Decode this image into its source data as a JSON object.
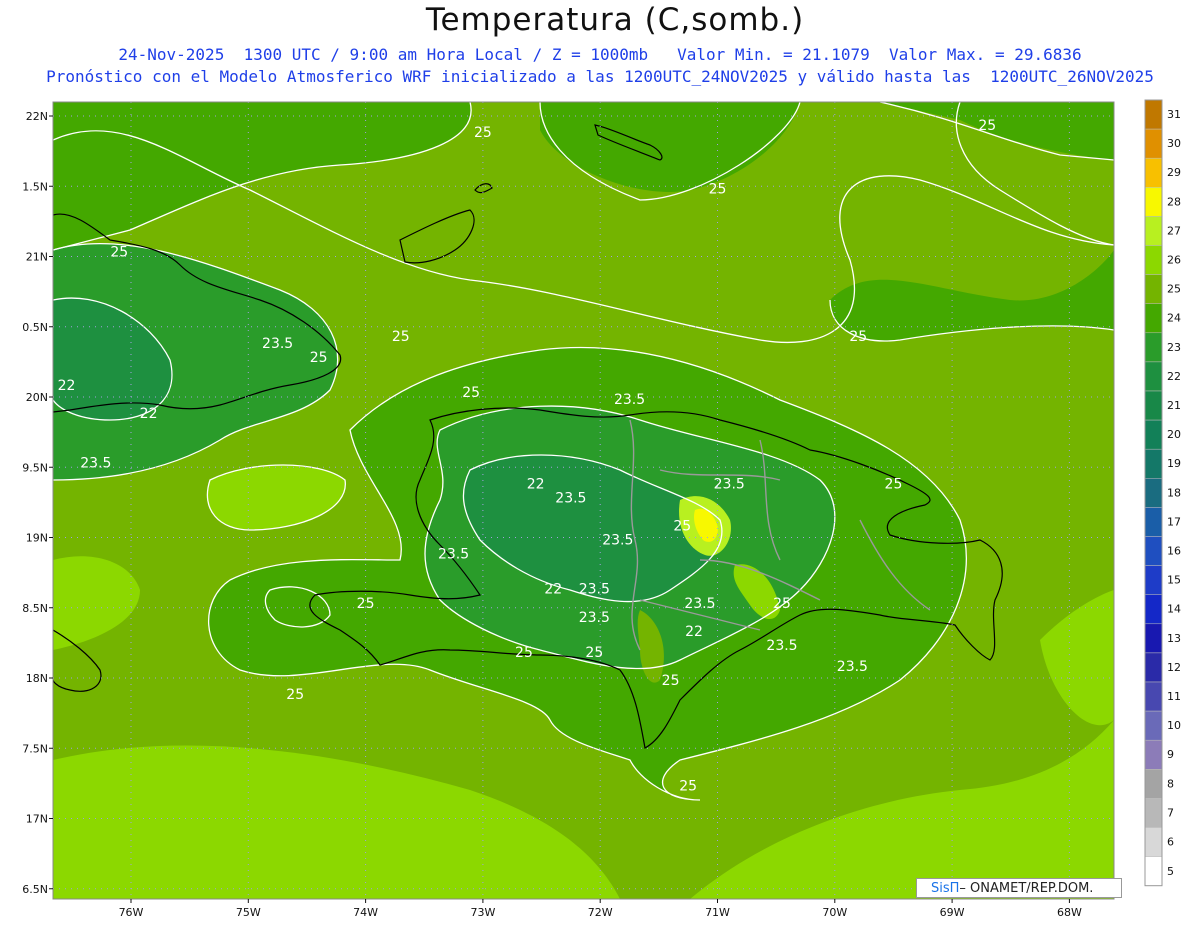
{
  "title": "Temperatura (C,somb.)",
  "subtitle_line1": "24-Nov-2025  1300 UTC / 9:00 am Hora Local / Z = 1000mb   Valor Min. = 21.1079  Valor Max. = 29.6836",
  "subtitle_line2": "Pronóstico con el Modelo Atmosferico WRF inicializado a las 1200UTC_24NOV2025 y válido hasta las  1200UTC_26NOV2025",
  "credit": {
    "brand": "SisΠ",
    "text": "– ONAMET/REP.DOM."
  },
  "axes": {
    "lat_labels": [
      "22N",
      "1.5N",
      "21N",
      "0.5N",
      "20N",
      "9.5N",
      "19N",
      "8.5N",
      "18N",
      "7.5N",
      "17N",
      "6.5N"
    ],
    "lon_labels": [
      "76W",
      "75W",
      "74W",
      "73W",
      "72W",
      "71W",
      "70W",
      "69W",
      "68W"
    ]
  },
  "colorbar": {
    "labels": [
      "31",
      "30",
      "29",
      "28",
      "27",
      "26",
      "25",
      "24",
      "23",
      "22",
      "21",
      "20",
      "19",
      "18",
      "17",
      "16",
      "15",
      "14",
      "13",
      "12",
      "11",
      "10",
      "9",
      "8",
      "7",
      "6",
      "5"
    ],
    "colors": [
      "#c07800",
      "#e09000",
      "#f8c000",
      "#f8f800",
      "#b8f020",
      "#8cd800",
      "#74b400",
      "#44a800",
      "#2a9c2a",
      "#1e9040",
      "#188848",
      "#128058",
      "#147868",
      "#1a6c80",
      "#1a5ea8",
      "#1f4fc0",
      "#1e3cc8",
      "#1428c8",
      "#1818b0",
      "#2a2aa8",
      "#4848b0",
      "#6a6ab8",
      "#8c7cb8",
      "#a4a4a4",
      "#b8b8b8",
      "#d8d8d8",
      "#ffffff"
    ]
  },
  "contour_labels": [
    {
      "text": "25",
      "lon": -73.0,
      "lat": 21.85
    },
    {
      "text": "25",
      "lon": -71.0,
      "lat": 21.45
    },
    {
      "text": "25",
      "lon": -68.7,
      "lat": 21.9
    },
    {
      "text": "25",
      "lon": -76.1,
      "lat": 21.0
    },
    {
      "text": "23.5",
      "lon": -74.75,
      "lat": 20.35
    },
    {
      "text": "25",
      "lon": -74.4,
      "lat": 20.25
    },
    {
      "text": "25",
      "lon": -73.7,
      "lat": 20.4
    },
    {
      "text": "25",
      "lon": -69.8,
      "lat": 20.4
    },
    {
      "text": "22",
      "lon": -76.55,
      "lat": 20.05
    },
    {
      "text": "22",
      "lon": -75.85,
      "lat": 19.85
    },
    {
      "text": "23.5",
      "lon": -76.3,
      "lat": 19.5
    },
    {
      "text": "25",
      "lon": -73.1,
      "lat": 20.0
    },
    {
      "text": "23.5",
      "lon": -71.75,
      "lat": 19.95
    },
    {
      "text": "22",
      "lon": -72.55,
      "lat": 19.35
    },
    {
      "text": "23.5",
      "lon": -72.25,
      "lat": 19.25
    },
    {
      "text": "23.5",
      "lon": -70.9,
      "lat": 19.35
    },
    {
      "text": "25",
      "lon": -71.3,
      "lat": 19.05
    },
    {
      "text": "25",
      "lon": -69.5,
      "lat": 19.35
    },
    {
      "text": "23.5",
      "lon": -71.85,
      "lat": 18.95
    },
    {
      "text": "23.5",
      "lon": -73.25,
      "lat": 18.85
    },
    {
      "text": "22",
      "lon": -72.4,
      "lat": 18.6
    },
    {
      "text": "23.5",
      "lon": -72.05,
      "lat": 18.6
    },
    {
      "text": "25",
      "lon": -74.0,
      "lat": 18.5
    },
    {
      "text": "23.5",
      "lon": -72.05,
      "lat": 18.4
    },
    {
      "text": "23.5",
      "lon": -71.15,
      "lat": 18.5
    },
    {
      "text": "25",
      "lon": -70.45,
      "lat": 18.5
    },
    {
      "text": "22",
      "lon": -71.2,
      "lat": 18.3
    },
    {
      "text": "25",
      "lon": -72.65,
      "lat": 18.15
    },
    {
      "text": "25",
      "lon": -72.05,
      "lat": 18.15
    },
    {
      "text": "23.5",
      "lon": -70.45,
      "lat": 18.2
    },
    {
      "text": "23.5",
      "lon": -69.85,
      "lat": 18.05
    },
    {
      "text": "25",
      "lon": -71.4,
      "lat": 17.95
    },
    {
      "text": "25",
      "lon": -74.6,
      "lat": 17.85
    },
    {
      "text": "25",
      "lon": -71.25,
      "lat": 17.2
    }
  ]
}
